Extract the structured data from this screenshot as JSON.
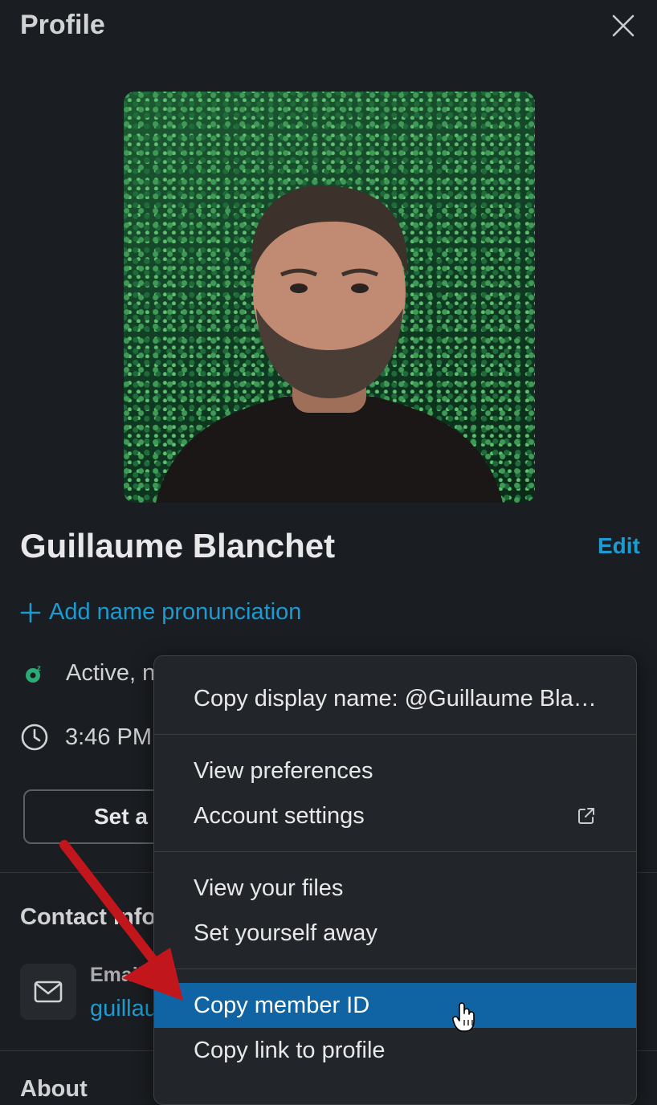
{
  "header": {
    "title": "Profile"
  },
  "profile": {
    "name": "Guillaume Blanchet",
    "edit_label": "Edit",
    "pronunciation_label": "Add name pronunciation",
    "status_text": "Active, n",
    "local_time": "3:46 PM",
    "set_status_label": "Set a s"
  },
  "contact": {
    "title": "Contact info",
    "email_label": "Email A",
    "email_value": "guillau",
    "more": ":"
  },
  "about": {
    "title": "About"
  },
  "context_menu": {
    "copy_display_name": "Copy display name: @Guillaume Bla…",
    "view_preferences": "View preferences",
    "account_settings": "Account settings",
    "view_files": "View your files",
    "set_away": "Set yourself away",
    "copy_member_id": "Copy member ID",
    "copy_link": "Copy link to profile",
    "highlighted_item": "Copy member ID"
  },
  "colors": {
    "background": "#1a1d21",
    "link": "#1d9bd1",
    "menu_highlight": "#1164a3",
    "annotation_arrow": "#c0161c",
    "status_active": "#2bac76"
  },
  "icons": {
    "close": "close-icon",
    "plus": "plus-icon",
    "status": "snooze-status-icon",
    "clock": "clock-icon",
    "email": "envelope-icon",
    "external": "external-link-icon",
    "cursor": "hand-pointer-icon"
  }
}
